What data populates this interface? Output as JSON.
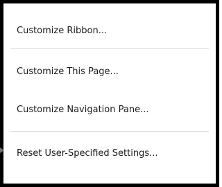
{
  "menu": {
    "items": [
      {
        "label": "Customize Ribbon..."
      },
      {
        "label": "Customize This Page..."
      },
      {
        "label": "Customize Navigation Pane..."
      },
      {
        "label": "Reset User-Specified Settings..."
      }
    ]
  },
  "colors": {
    "border": "#000000",
    "background": "#ffffff",
    "separator": "#d4d4d4",
    "text": "#1a1a1a"
  },
  "icons": {
    "pointer": "submenu-pointer-icon"
  }
}
